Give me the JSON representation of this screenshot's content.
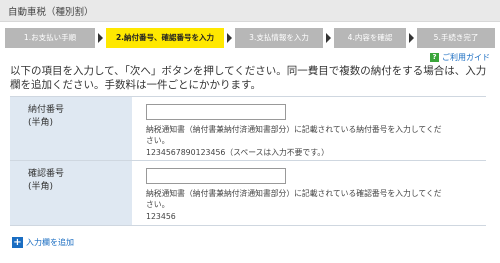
{
  "header": {
    "title": "自動車税（種別割）"
  },
  "steps": [
    {
      "label": "1.お支払い手順",
      "active": false
    },
    {
      "label": "2.納付番号、確認番号を入力",
      "active": true
    },
    {
      "label": "3.支払情報を入力",
      "active": false
    },
    {
      "label": "4.内容を確認",
      "active": false
    },
    {
      "label": "5.手続き完了",
      "active": false
    }
  ],
  "guide_link": "ご利用ガイド",
  "intro": "以下の項目を入力して、「次へ」ボタンを押してください。同一費目で複数の納付をする場合は、入力欄を追加ください。手数料は一件ごとにかかります。",
  "form": {
    "rows": [
      {
        "label": "納付番号",
        "sublabel": "(半角)",
        "value": "",
        "help": "納税通知書（納付書兼納付済通知書部分）に記載されている納付番号を入力してください。",
        "example": "1234567890123456（スペースは入力不要です。）"
      },
      {
        "label": "確認番号",
        "sublabel": "(半角)",
        "value": "",
        "help": "納税通知書（納付書兼納付済通知書部分）に記載されている確認番号を入力してください。",
        "example": "123456"
      }
    ]
  },
  "add_field": {
    "label": "入力欄を追加"
  },
  "colors": {
    "active_step": "#ffe800",
    "inactive_step": "#b7b7b7",
    "label_bg": "#dfe8f2",
    "link": "#1a6dc2"
  },
  "icons": {
    "guide": "question-icon",
    "add": "plus-icon",
    "step_separator": "arrow-right-icon"
  }
}
